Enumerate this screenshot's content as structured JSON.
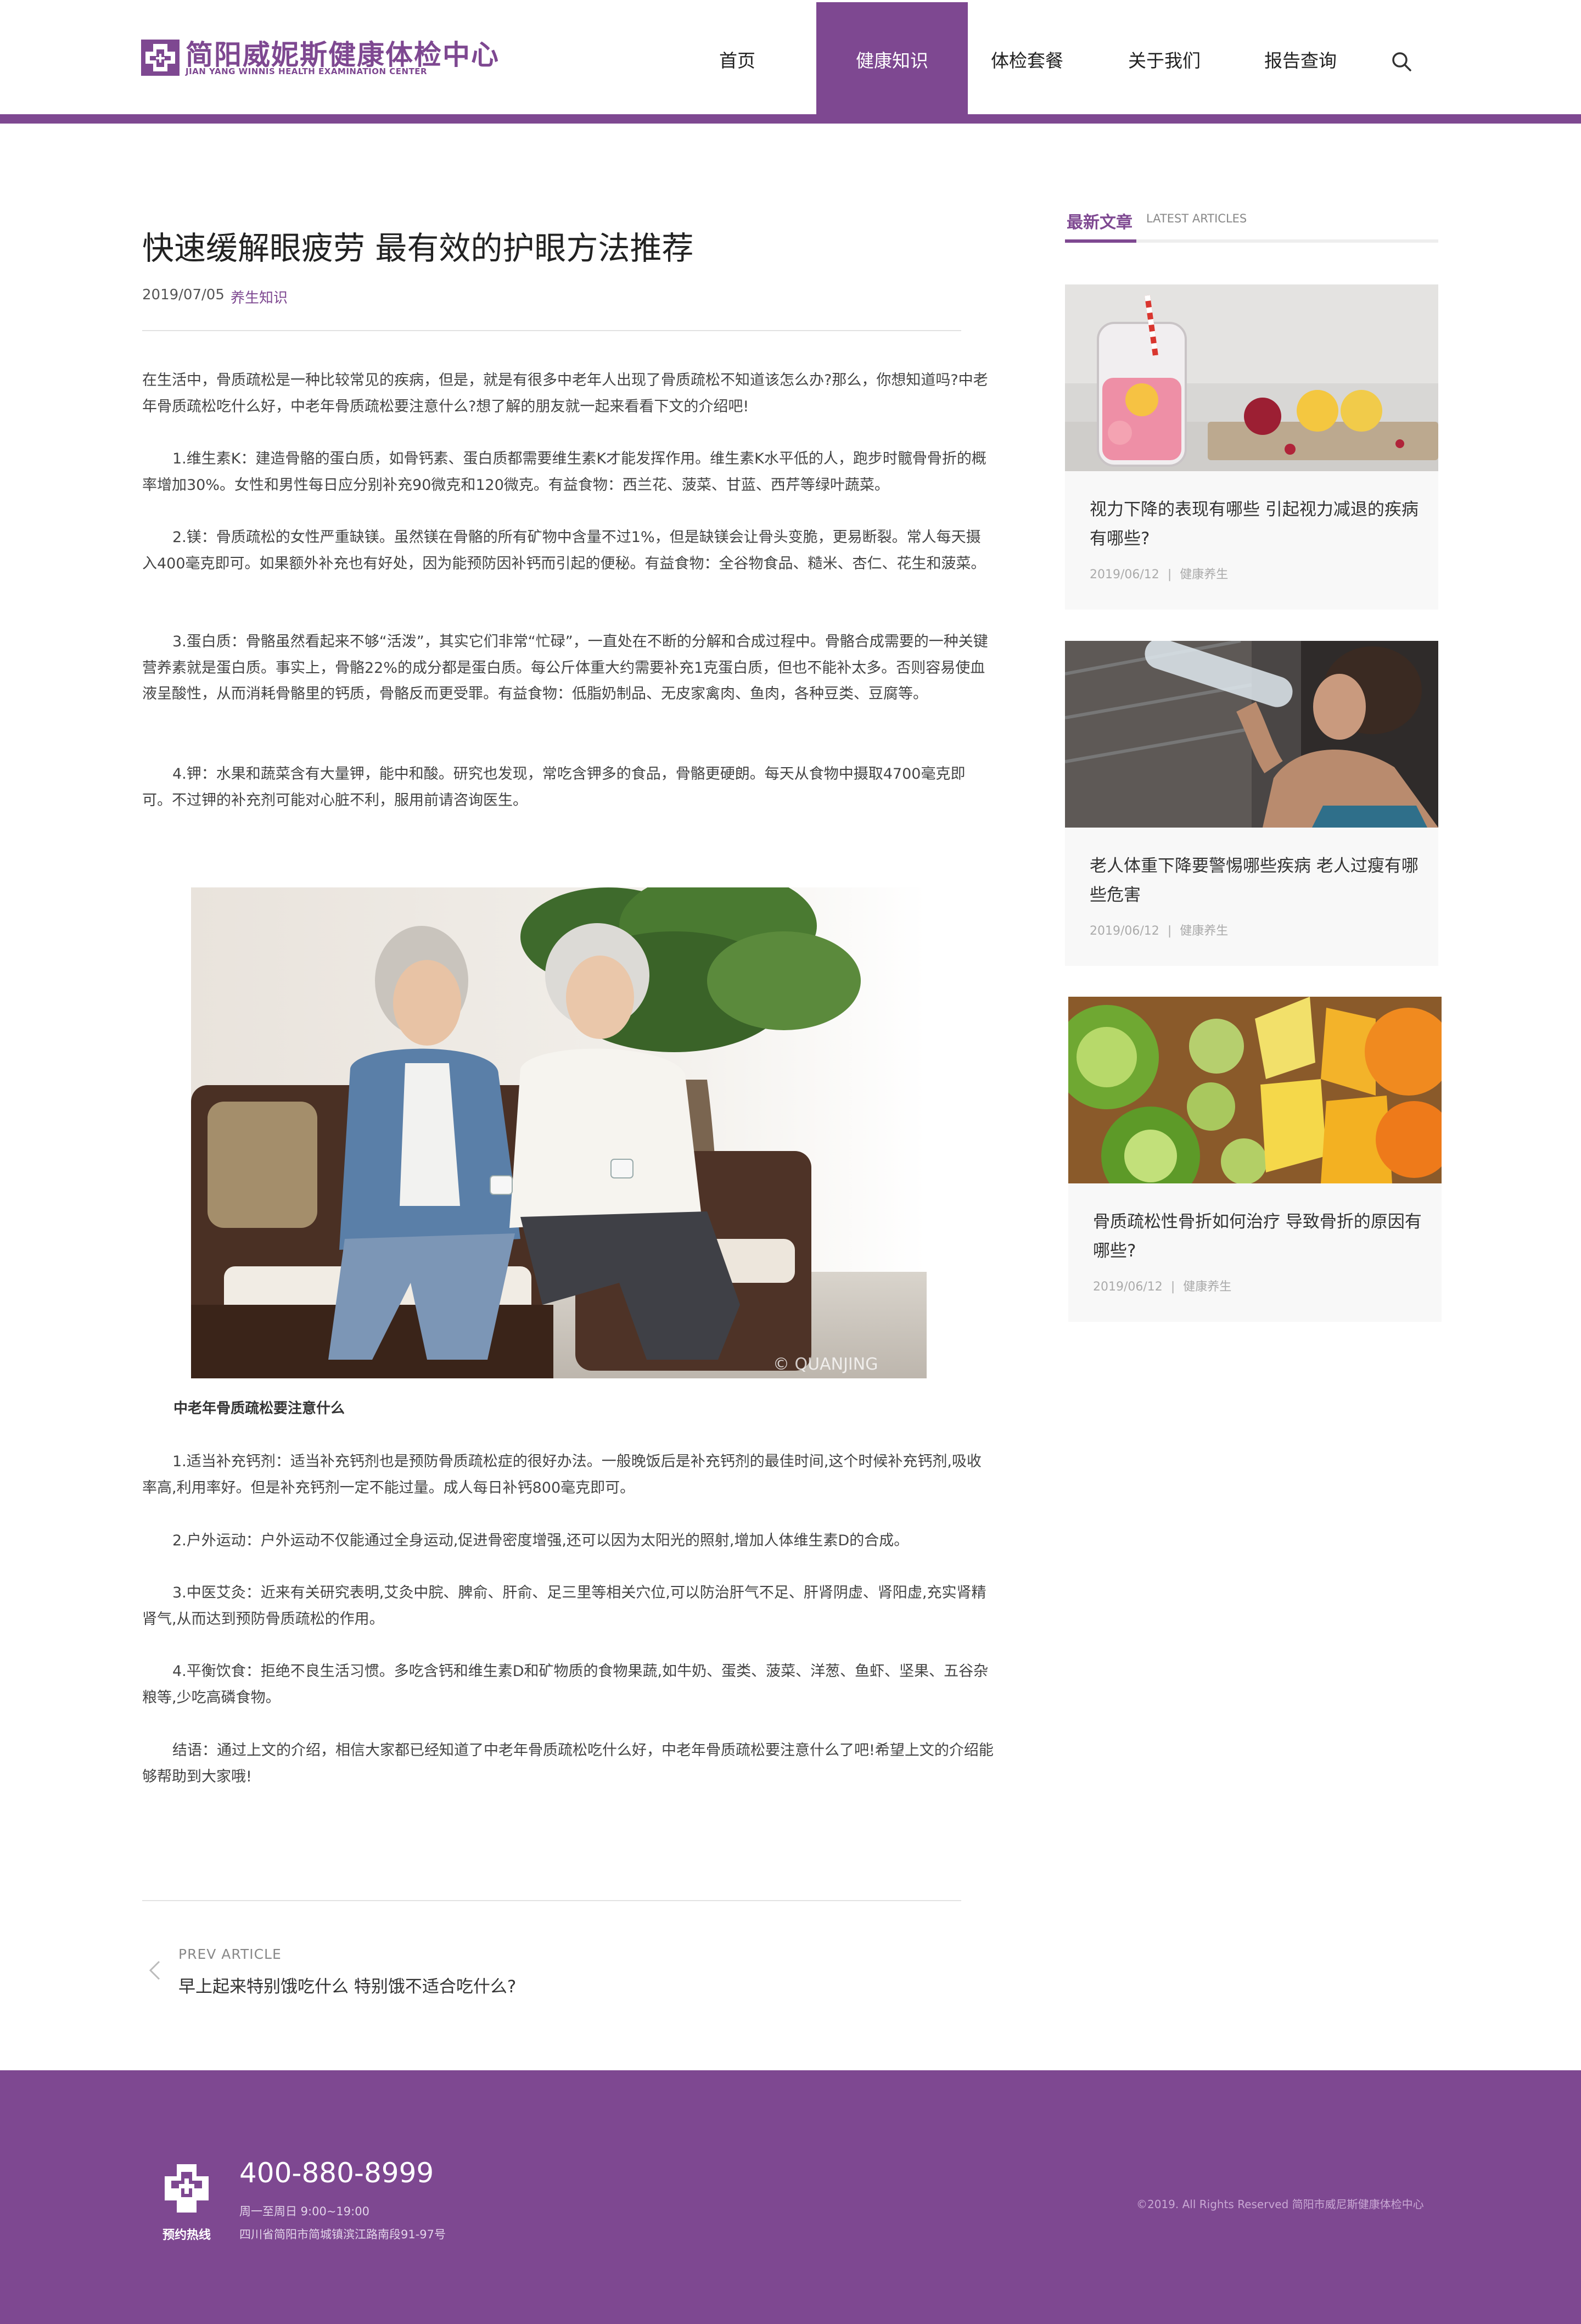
{
  "header": {
    "logo_cn": "简阳威妮斯健康体检中心",
    "logo_en": "JIAN YANG WINNIS HEALTH EXAMINATION CENTER",
    "nav": [
      {
        "label": "首页",
        "active": false
      },
      {
        "label": "健康知识",
        "active": true
      },
      {
        "label": "体检套餐",
        "active": false
      },
      {
        "label": "关于我们",
        "active": false
      },
      {
        "label": "报告查询",
        "active": false
      }
    ],
    "accent_color": "#7e4891"
  },
  "article": {
    "title": "快速缓解眼疲劳 最有效的护眼方法推荐",
    "date": "2019/07/05",
    "category": "养生知识",
    "paragraphs": [
      "在生活中，骨质疏松是一种比较常见的疾病，但是，就是有很多中老年人出现了骨质疏松不知道该怎么办?那么，你想知道吗?中老年骨质疏松吃什么好，中老年骨质疏松要注意什么?想了解的朋友就一起来看看下文的介绍吧!",
      "1.维生素K：建造骨骼的蛋白质，如骨钙素、蛋白质都需要维生素K才能发挥作用。维生素K水平低的人，跑步时髋骨骨折的概率增加30%。女性和男性每日应分别补充90微克和120微克。有益食物：西兰花、菠菜、甘蓝、西芹等绿叶蔬菜。",
      "2.镁：骨质疏松的女性严重缺镁。虽然镁在骨骼的所有矿物中含量不过1%，但是缺镁会让骨头变脆，更易断裂。常人每天摄入400毫克即可。如果额外补充也有好处，因为能预防因补钙而引起的便秘。有益食物：全谷物食品、糙米、杏仁、花生和菠菜。",
      "3.蛋白质：骨骼虽然看起来不够“活泼”，其实它们非常“忙碌”，一直处在不断的分解和合成过程中。骨骼合成需要的一种关键营养素就是蛋白质。事实上，骨骼22%的成分都是蛋白质。每公斤体重大约需要补充1克蛋白质，但也不能补太多。否则容易使血液呈酸性，从而消耗骨骼里的钙质，骨骼反而更受罪。有益食物：低脂奶制品、无皮家禽肉、鱼肉，各种豆类、豆腐等。",
      "4.钾：水果和蔬菜含有大量钾，能中和酸。研究也发现，常吃含钾多的食品，骨骼更硬朗。每天从食物中摄取4700毫克即可。不过钾的补充剂可能对心脏不利，服用前请咨询医生。"
    ],
    "image_caption": "中老年骨质疏松要注意什么",
    "watermark": "© QUANJING",
    "paragraphs2": [
      "1.适当补充钙剂：适当补充钙剂也是预防骨质疏松症的很好办法。一般晚饭后是补充钙剂的最佳时间,这个时候补充钙剂,吸收率高,利用率好。但是补充钙剂一定不能过量。成人每日补钙800毫克即可。",
      "2.户外运动：户外运动不仅能通过全身运动,促进骨密度增强,还可以因为太阳光的照射,增加人体维生素D的合成。",
      "3.中医艾灸：近来有关研究表明,艾灸中脘、脾俞、肝俞、足三里等相关穴位,可以防治肝气不足、肝肾阴虚、肾阳虚,充实肾精肾气,从而达到预防骨质疏松的作用。",
      "4.平衡饮食：拒绝不良生活习惯。多吃含钙和维生素D和矿物质的食物果蔬,如牛奶、蛋类、菠菜、洋葱、鱼虾、坚果、五谷杂粮等,少吃高磷食物。",
      "结语：通过上文的介绍，相信大家都已经知道了中老年骨质疏松吃什么好，中老年骨质疏松要注意什么了吧!希望上文的介绍能够帮助到大家哦!"
    ],
    "prev_label": "PREV ARTICLE",
    "prev_title": "早上起来特别饿吃什么 特别饿不适合吃什么?"
  },
  "sidebar": {
    "title_cn": "最新文章",
    "title_en": "LATEST ARTICLES",
    "cards": [
      {
        "title": "视力下降的表现有哪些 引起视力减退的疾病有哪些?",
        "date": "2019/06/12",
        "sep": "|",
        "category": "健康养生"
      },
      {
        "title": "老人体重下降要警惕哪些疾病 老人过瘦有哪些危害",
        "date": "2019/06/12",
        "sep": "|",
        "category": "健康养生"
      },
      {
        "title": "骨质疏松性骨折如何治疗 导致骨折的原因有哪些?",
        "date": "2019/06/12",
        "sep": "|",
        "category": "健康养生"
      }
    ]
  },
  "footer": {
    "hotline_label": "预约热线",
    "phone": "400-880-8999",
    "hours": "周一至周日 9:00~19:00",
    "address": "四川省简阳市简城镇滨江路南段91-97号",
    "copyright": "©2019. All Rights Reserved 简阳市威尼斯健康体检中心"
  }
}
